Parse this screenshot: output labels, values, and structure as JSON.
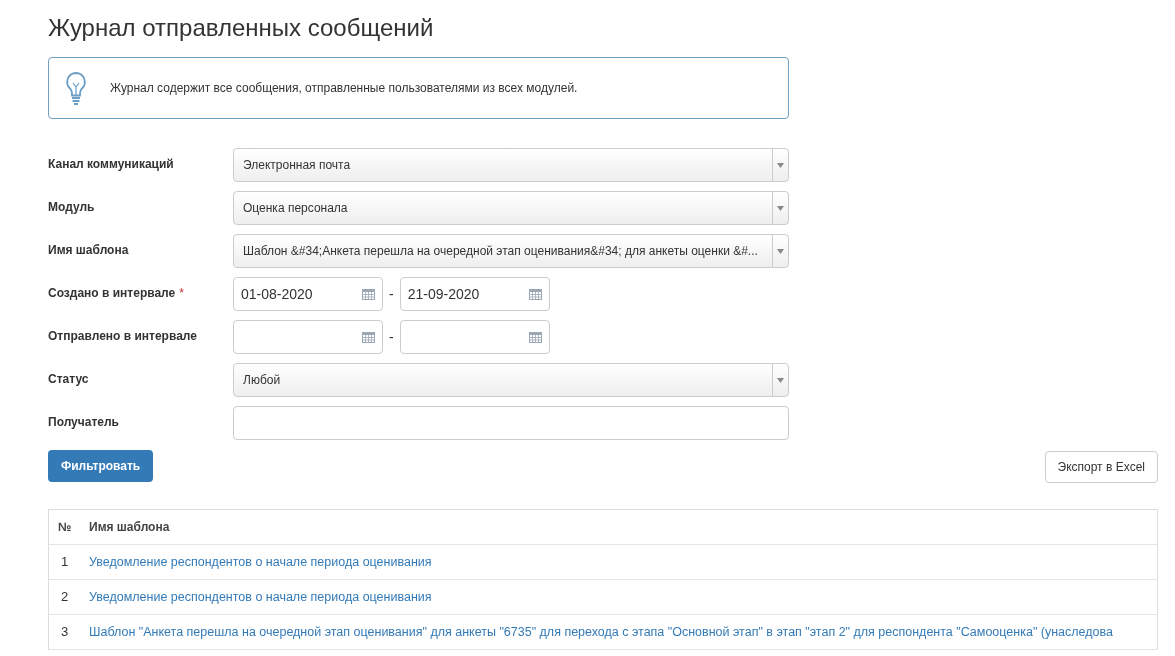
{
  "title": "Журнал отправленных сообщений",
  "info": "Журнал содержит все сообщения, отправленные пользователями из всех модулей.",
  "filters": [
    {
      "kind": "select",
      "label": "Канал коммуникаций",
      "required": false,
      "value": "Электронная почта"
    },
    {
      "kind": "select",
      "label": "Модуль",
      "required": false,
      "value": "Оценка персонала"
    },
    {
      "kind": "select",
      "label": "Имя шаблона",
      "required": false,
      "value": "Шаблон &#34;Анкета перешла на очередной этап оценивания&#34; для анкеты оценки &#..."
    },
    {
      "kind": "daterange",
      "label": "Создано в интервале",
      "required": true,
      "from": "01-08-2020",
      "separator": "-",
      "to": "21-09-2020"
    },
    {
      "kind": "daterange",
      "label": "Отправлено в интервале",
      "required": false,
      "separator": "-"
    },
    {
      "kind": "select",
      "label": "Статус",
      "required": false,
      "value": "Любой"
    },
    {
      "kind": "text",
      "label": "Получатель",
      "required": false
    }
  ],
  "required_mark": "*",
  "filter_button": "Фильтровать",
  "export_button": "Экспорт в Excel",
  "table": {
    "columns": [
      "№",
      "Имя шаблона"
    ],
    "rows": [
      {
        "num": "1",
        "name": "Уведомление респондентов о начале периода оценивания"
      },
      {
        "num": "2",
        "name": "Уведомление респондентов о начале периода оценивания"
      },
      {
        "num": "3",
        "name": "Шаблон \"Анкета перешла на очередной этап оценивания\" для анкеты \"6735\" для перехода с этапа \"Основной этап\" в этап \"этап 2\" для респондента \"Самооценка\" (унаследова"
      }
    ]
  }
}
